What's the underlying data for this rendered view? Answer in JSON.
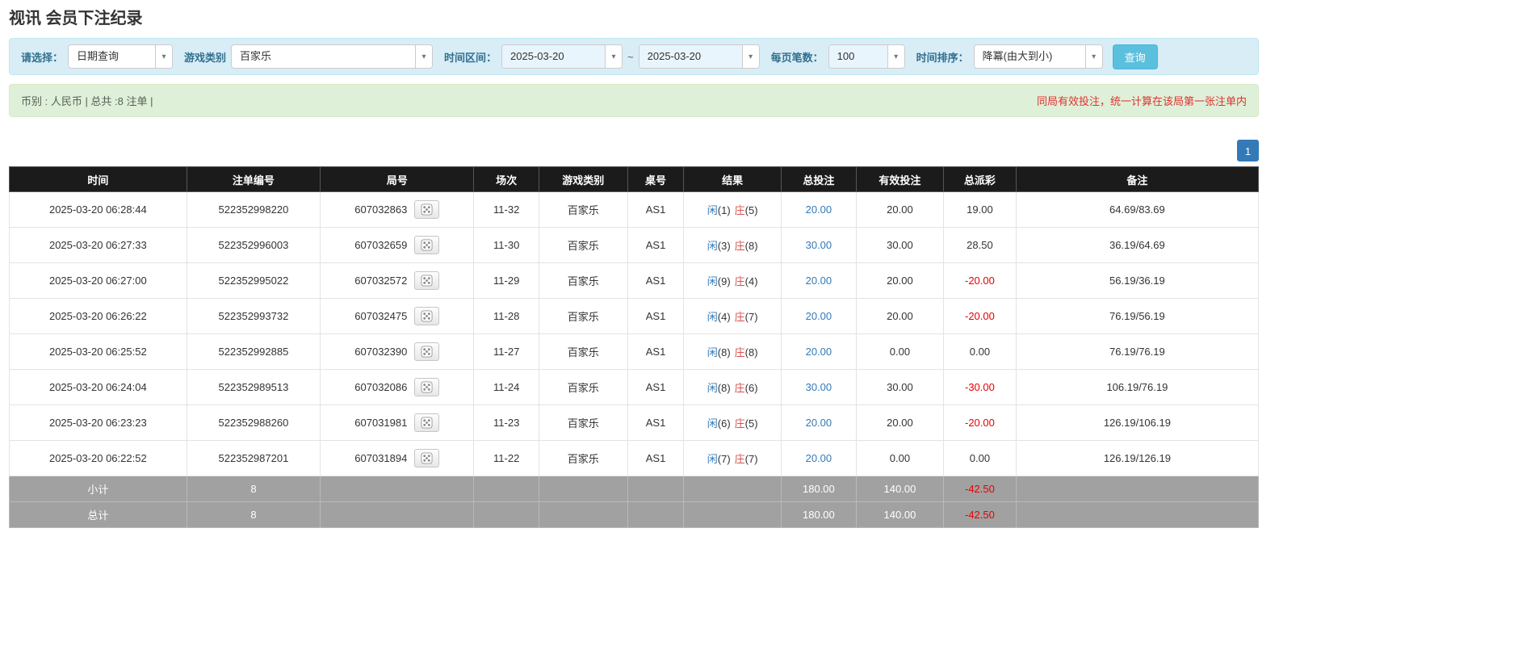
{
  "page": {
    "title": "视讯 会员下注纪录"
  },
  "icons": {
    "caret_down": "▾"
  },
  "colors": {
    "header_bg": "#1b1b1b",
    "link_blue": "#337ab7",
    "banker_red": "#d9534f",
    "negative_red": "#e60000",
    "search_button_bg": "#5bc0de",
    "filter_bar_bg": "#d9edf7",
    "summary_bar_bg": "#dff0d8"
  },
  "filters": {
    "select_label": "请选择：",
    "select_value": "日期查询",
    "game_type_label": "游戏类别",
    "game_type_value": "百家乐",
    "time_range_label": "时间区间：",
    "date_from": "2025-03-20",
    "tilde": "~",
    "date_to": "2025-03-20",
    "page_size_label": "每页笔数：",
    "page_size_value": "100",
    "sort_label": "时间排序：",
    "sort_value": "降冪(由大到小)",
    "search_button": "查询"
  },
  "summary": {
    "left": "币别 : 人民币 | 总共 :8 注单 |",
    "right": "同局有效投注，统一计算在该局第一张注单内"
  },
  "pagination": {
    "page": "1"
  },
  "table": {
    "headers": [
      "时间",
      "注单编号",
      "局号",
      "场次",
      "游戏类别",
      "桌号",
      "结果",
      "总投注",
      "有效投注",
      "总派彩",
      "备注"
    ],
    "rows": [
      {
        "time": "2025-03-20 06:28:44",
        "bet_id": "522352998220",
        "round_id": "607032863",
        "session": "11-32",
        "game_type": "百家乐",
        "table_no": "AS1",
        "player": "闲",
        "player_score": "(1)",
        "banker": "庄",
        "banker_score": "(5)",
        "total_bet": "20.00",
        "valid_bet": "20.00",
        "payout": "19.00",
        "note": "64.69/83.69"
      },
      {
        "time": "2025-03-20 06:27:33",
        "bet_id": "522352996003",
        "round_id": "607032659",
        "session": "11-30",
        "game_type": "百家乐",
        "table_no": "AS1",
        "player": "闲",
        "player_score": "(3)",
        "banker": "庄",
        "banker_score": "(8)",
        "total_bet": "30.00",
        "valid_bet": "30.00",
        "payout": "28.50",
        "note": "36.19/64.69"
      },
      {
        "time": "2025-03-20 06:27:00",
        "bet_id": "522352995022",
        "round_id": "607032572",
        "session": "11-29",
        "game_type": "百家乐",
        "table_no": "AS1",
        "player": "闲",
        "player_score": "(9)",
        "banker": "庄",
        "banker_score": "(4)",
        "total_bet": "20.00",
        "valid_bet": "20.00",
        "payout": "-20.00",
        "note": "56.19/36.19"
      },
      {
        "time": "2025-03-20 06:26:22",
        "bet_id": "522352993732",
        "round_id": "607032475",
        "session": "11-28",
        "game_type": "百家乐",
        "table_no": "AS1",
        "player": "闲",
        "player_score": "(4)",
        "banker": "庄",
        "banker_score": "(7)",
        "total_bet": "20.00",
        "valid_bet": "20.00",
        "payout": "-20.00",
        "note": "76.19/56.19"
      },
      {
        "time": "2025-03-20 06:25:52",
        "bet_id": "522352992885",
        "round_id": "607032390",
        "session": "11-27",
        "game_type": "百家乐",
        "table_no": "AS1",
        "player": "闲",
        "player_score": "(8)",
        "banker": "庄",
        "banker_score": "(8)",
        "total_bet": "20.00",
        "valid_bet": "0.00",
        "payout": "0.00",
        "note": "76.19/76.19"
      },
      {
        "time": "2025-03-20 06:24:04",
        "bet_id": "522352989513",
        "round_id": "607032086",
        "session": "11-24",
        "game_type": "百家乐",
        "table_no": "AS1",
        "player": "闲",
        "player_score": "(8)",
        "banker": "庄",
        "banker_score": "(6)",
        "total_bet": "30.00",
        "valid_bet": "30.00",
        "payout": "-30.00",
        "note": "106.19/76.19"
      },
      {
        "time": "2025-03-20 06:23:23",
        "bet_id": "522352988260",
        "round_id": "607031981",
        "session": "11-23",
        "game_type": "百家乐",
        "table_no": "AS1",
        "player": "闲",
        "player_score": "(6)",
        "banker": "庄",
        "banker_score": "(5)",
        "total_bet": "20.00",
        "valid_bet": "20.00",
        "payout": "-20.00",
        "note": "126.19/106.19"
      },
      {
        "time": "2025-03-20 06:22:52",
        "bet_id": "522352987201",
        "round_id": "607031894",
        "session": "11-22",
        "game_type": "百家乐",
        "table_no": "AS1",
        "player": "闲",
        "player_score": "(7)",
        "banker": "庄",
        "banker_score": "(7)",
        "total_bet": "20.00",
        "valid_bet": "0.00",
        "payout": "0.00",
        "note": "126.19/126.19"
      }
    ],
    "footer": [
      {
        "label": "小计",
        "count": "8",
        "total_bet": "180.00",
        "valid_bet": "140.00",
        "payout": "-42.50"
      },
      {
        "label": "总计",
        "count": "8",
        "total_bet": "180.00",
        "valid_bet": "140.00",
        "payout": "-42.50"
      }
    ]
  }
}
